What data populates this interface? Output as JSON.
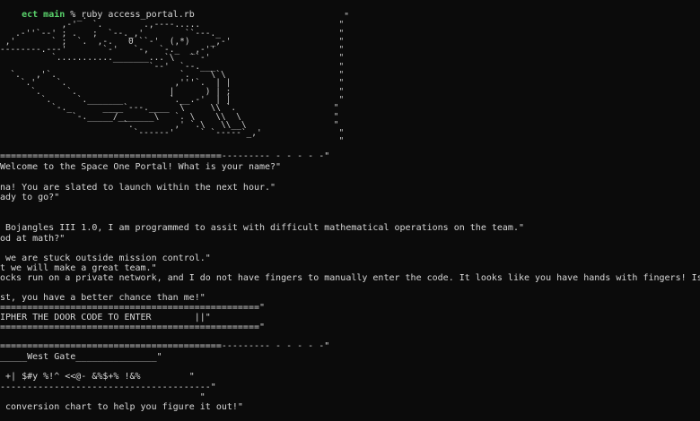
{
  "prompt": {
    "directory": "ect main",
    "symbol": " % ",
    "command": "ruby access_portal.rb"
  },
  "ascii_art": [
    "               _.                                                  \"",
    "            ,-'   `.        .,----.....                           \"",
    "   .-''`--' ; .   ;  `--._,'        ``---._                       \"",
    " ,'       ` ;  `.  ,-.   0 ``-'  (,*)    _,-'                     \"",
    "--------.---'       `-'   `-,  `-._  _,-''                        \"",
    "          `..........._______...`\\   ``-'                         \"",
    "                             `--'  `--.___                        \"",
    "  `.   ,'`.                        `.    \\`\\                      \"",
    "    `.'    `.                     ,'''`.  | |                     \"",
    "      `.     `.                  |      ) | ;                     \"",
    "        `.     `._______         `.__.-'  | |                     \"",
    "          `-._      ____`---.____  \\     \\\\ `.                   \"",
    "              `-._____/_______\\   `. \\    \\\\  \\                  \"",
    "                        `.        ,' `.\\   \\\\__\\                 \"",
    "                          `------'     ` `-----`_,'               \"",
    "                                                                  \""
  ],
  "lines": [
    "=========================================--------- - - - - -\"",
    "Welcome to the Space One Portal! What is your name?\"",
    "",
    "na! You are slated to launch within the next hour.\"",
    "ady to go?\"",
    "",
    "",
    " Bojangles III 1.0, I am programmed to assit with difficult mathematical operations on the team.\"",
    "od at math?\"",
    "",
    " we are stuck outside mission control.\"",
    "t we will make a great team.\"",
    "ocks run on a private network, and I do not have fingers to manually enter the code. It looks like you have hands with fingers! Is this true?\"",
    "",
    "st, you have a better chance than me!\"",
    "================================================\"",
    "IPHER THE DOOR CODE TO ENTER        ||\"",
    "================================================\"",
    "=========================================--------- - - - - -\"",
    "_____West Gate_______________\"",
    "",
    " +| $#y %!^ <<@- &%$+% !&%         \"",
    "---------------------------------------\"",
    "                                     \"",
    " conversion chart to help you figure it out!\""
  ]
}
